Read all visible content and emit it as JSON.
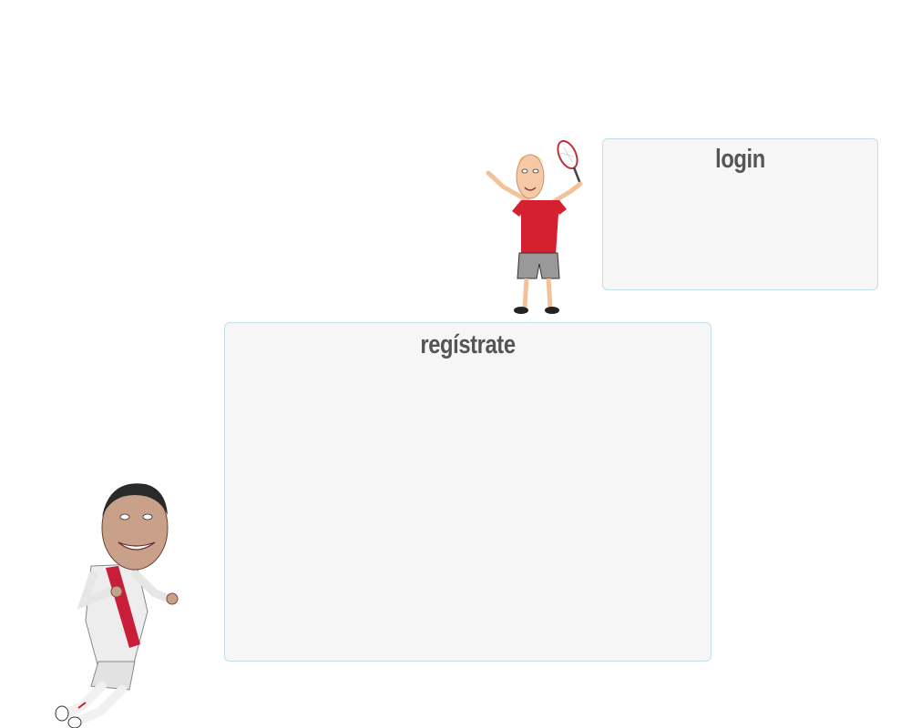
{
  "login": {
    "title": "login"
  },
  "register": {
    "title": "regístrate"
  },
  "illustrations": {
    "tennis": "tennis-player-caricature",
    "soccer": "soccer-player-caricature"
  },
  "colors": {
    "panel_background": "#f6f6f6",
    "panel_border": "#bfe0ea",
    "title_text": "#555555",
    "tennis_shirt": "#d42030",
    "soccer_sash": "#c81e3a"
  }
}
